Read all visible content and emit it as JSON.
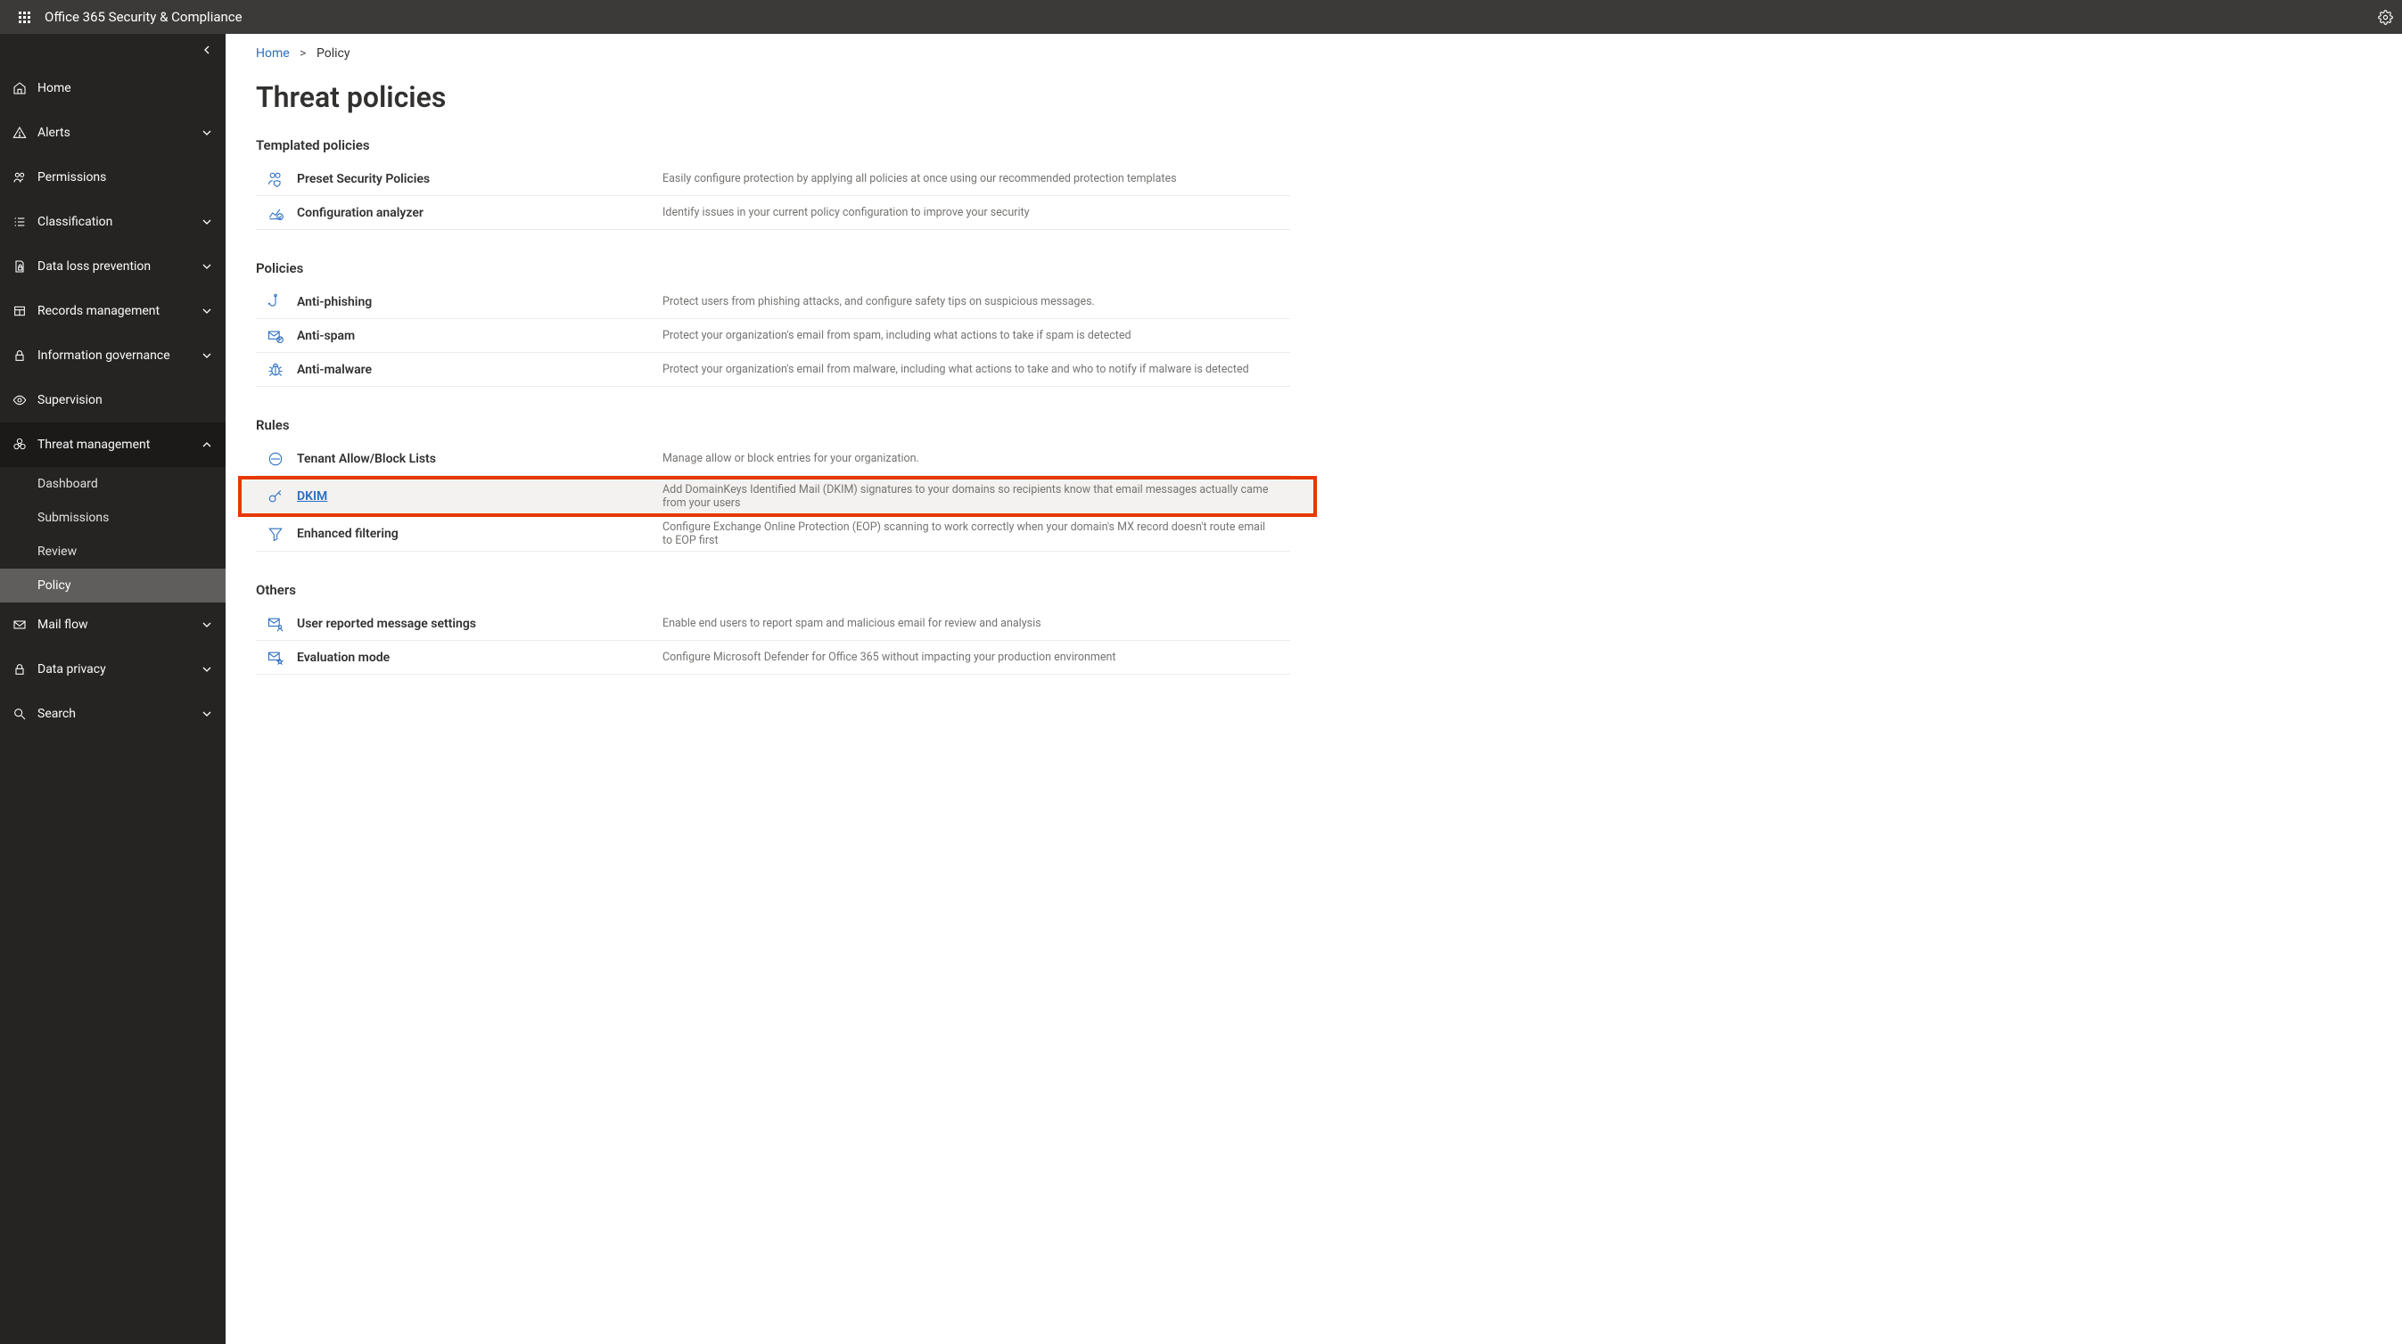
{
  "header": {
    "app_title": "Office 365 Security & Compliance"
  },
  "breadcrumb": {
    "home": "Home",
    "current": "Policy"
  },
  "page": {
    "title": "Threat policies"
  },
  "sidebar": {
    "items": [
      {
        "id": "home",
        "label": "Home",
        "expandable": false
      },
      {
        "id": "alerts",
        "label": "Alerts",
        "expandable": true
      },
      {
        "id": "permissions",
        "label": "Permissions",
        "expandable": false
      },
      {
        "id": "classification",
        "label": "Classification",
        "expandable": true
      },
      {
        "id": "dlp",
        "label": "Data loss prevention",
        "expandable": true
      },
      {
        "id": "records",
        "label": "Records management",
        "expandable": true
      },
      {
        "id": "infogov",
        "label": "Information governance",
        "expandable": true
      },
      {
        "id": "supervision",
        "label": "Supervision",
        "expandable": false
      },
      {
        "id": "threat",
        "label": "Threat management",
        "expandable": true,
        "expanded": true,
        "children": [
          {
            "id": "dashboard",
            "label": "Dashboard"
          },
          {
            "id": "submissions",
            "label": "Submissions"
          },
          {
            "id": "review",
            "label": "Review"
          },
          {
            "id": "policy",
            "label": "Policy",
            "active": true
          }
        ]
      },
      {
        "id": "mailflow",
        "label": "Mail flow",
        "expandable": true
      },
      {
        "id": "privacy",
        "label": "Data privacy",
        "expandable": true
      },
      {
        "id": "search",
        "label": "Search",
        "expandable": true
      }
    ]
  },
  "sections": [
    {
      "id": "templated",
      "title": "Templated policies",
      "rows": [
        {
          "id": "preset",
          "icon": "people-shield",
          "label": "Preset Security Policies",
          "desc": "Easily configure protection by applying all policies at once using our recommended protection templates"
        },
        {
          "id": "analyzer",
          "icon": "chart-check",
          "label": "Configuration analyzer",
          "desc": "Identify issues in your current policy configuration to improve your security"
        }
      ]
    },
    {
      "id": "policies",
      "title": "Policies",
      "rows": [
        {
          "id": "antiphishing",
          "icon": "hook",
          "label": "Anti-phishing",
          "desc": "Protect users from phishing attacks, and configure safety tips on suspicious messages."
        },
        {
          "id": "antispam",
          "icon": "mail-block",
          "label": "Anti-spam",
          "desc": "Protect your organization's email from spam, including what actions to take if spam is detected"
        },
        {
          "id": "antimalware",
          "icon": "bug",
          "label": "Anti-malware",
          "desc": "Protect your organization's email from malware, including what actions to take and who to notify if malware is detected"
        }
      ]
    },
    {
      "id": "rules",
      "title": "Rules",
      "rows": [
        {
          "id": "tenant",
          "icon": "block-circle",
          "label": "Tenant Allow/Block Lists",
          "desc": "Manage allow or block entries for your organization."
        },
        {
          "id": "dkim",
          "icon": "key",
          "label": "DKIM",
          "desc": "Add DomainKeys Identified Mail (DKIM) signatures to your domains so recipients know that email messages actually came from your users",
          "highlighted": true
        },
        {
          "id": "enhanced",
          "icon": "filter",
          "label": "Enhanced filtering",
          "desc": "Configure Exchange Online Protection (EOP) scanning to work correctly when your domain's MX record doesn't route email to EOP first"
        }
      ]
    },
    {
      "id": "others",
      "title": "Others",
      "rows": [
        {
          "id": "userreported",
          "icon": "mail-person",
          "label": "User reported message settings",
          "desc": "Enable end users to report spam and malicious email for review and analysis"
        },
        {
          "id": "evaluation",
          "icon": "mail-star",
          "label": "Evaluation mode",
          "desc": "Configure Microsoft Defender for Office 365 without impacting your production environment"
        }
      ]
    }
  ]
}
